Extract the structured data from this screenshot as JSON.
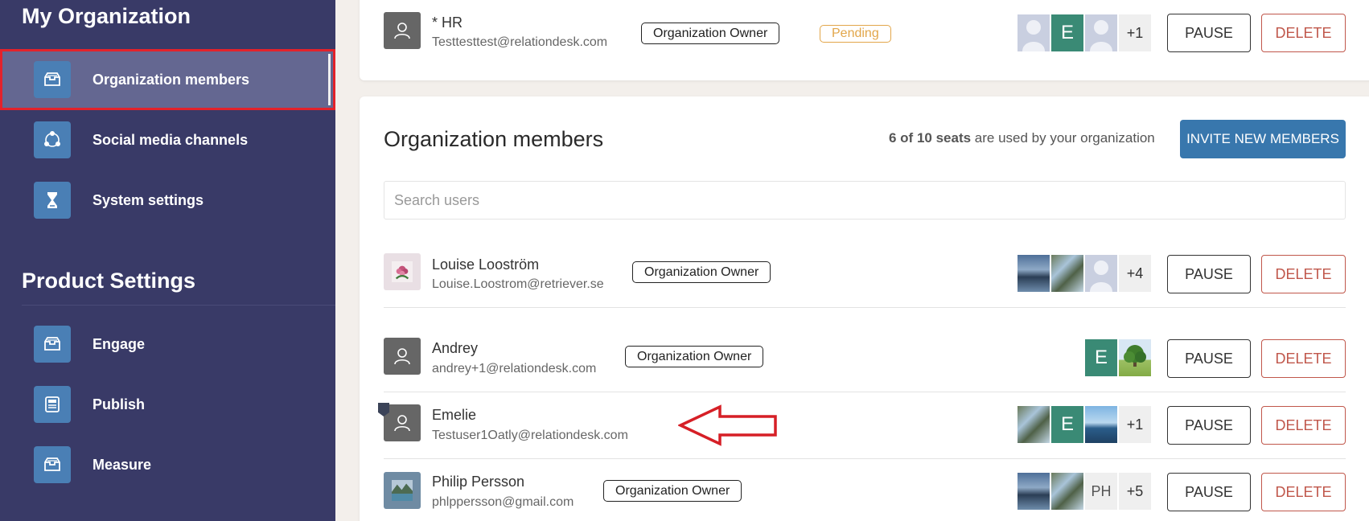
{
  "sidebar": {
    "my_org_title": "My Organization",
    "product_title": "Product Settings",
    "org_items": [
      {
        "label": "Organization members",
        "icon": "inbox-icon",
        "active": true
      },
      {
        "label": "Social media channels",
        "icon": "share-nodes-icon",
        "active": false
      },
      {
        "label": "System settings",
        "icon": "hourglass-icon",
        "active": false
      }
    ],
    "product_items": [
      {
        "label": "Engage",
        "icon": "inbox-icon"
      },
      {
        "label": "Publish",
        "icon": "document-icon"
      },
      {
        "label": "Measure",
        "icon": "inbox-icon"
      }
    ]
  },
  "pending_member": {
    "name": "* HR",
    "email": "Testtesttest@relationdesk.com",
    "role": "Organization Owner",
    "status": "Pending",
    "channels": [
      "ghost-avatar",
      "E",
      "ghost-avatar",
      "+1"
    ],
    "pause_label": "PAUSE",
    "delete_label": "DELETE"
  },
  "members_card": {
    "title": "Organization members",
    "seats_used": "6 of 10 seats",
    "seats_suffix": " are used by your organization",
    "invite_label": "INVITE NEW MEMBERS",
    "search_placeholder": "Search users"
  },
  "members": [
    {
      "name": "Louise Looström",
      "email": "Louise.Loostrom@retriever.se",
      "role": "Organization Owner",
      "channels": [
        "lake-photo",
        "flower-photo",
        "ghost-avatar",
        "+4"
      ],
      "pause_label": "PAUSE",
      "delete_label": "DELETE"
    },
    {
      "name": "Andrey",
      "email": "andrey+1@relationdesk.com",
      "role": "Organization Owner",
      "channels": [
        "E",
        "tree-photo"
      ],
      "pause_label": "PAUSE",
      "delete_label": "DELETE"
    },
    {
      "name": "Emelie",
      "email": "Testuser1Oatly@relationdesk.com",
      "role": "",
      "channels": [
        "flower-photo",
        "E",
        "sea-photo",
        "+1"
      ],
      "pause_label": "PAUSE",
      "delete_label": "DELETE"
    },
    {
      "name": "Philip Persson",
      "email": "phlppersson@gmail.com",
      "role": "Organization Owner",
      "channels": [
        "lake-photo",
        "flower-photo",
        "PH",
        "+5"
      ],
      "pause_label": "PAUSE",
      "delete_label": "DELETE"
    }
  ],
  "colors": {
    "sidebar_bg": "#393a67",
    "active_item_bg": "#646791",
    "highlight_outline": "#e3222b",
    "icon_tile": "#4a7fb5",
    "invite_button": "#3877ad",
    "delete_red": "#c0574b",
    "pending_amber": "#e2a64a",
    "channel_e_green": "#3a8a75"
  }
}
